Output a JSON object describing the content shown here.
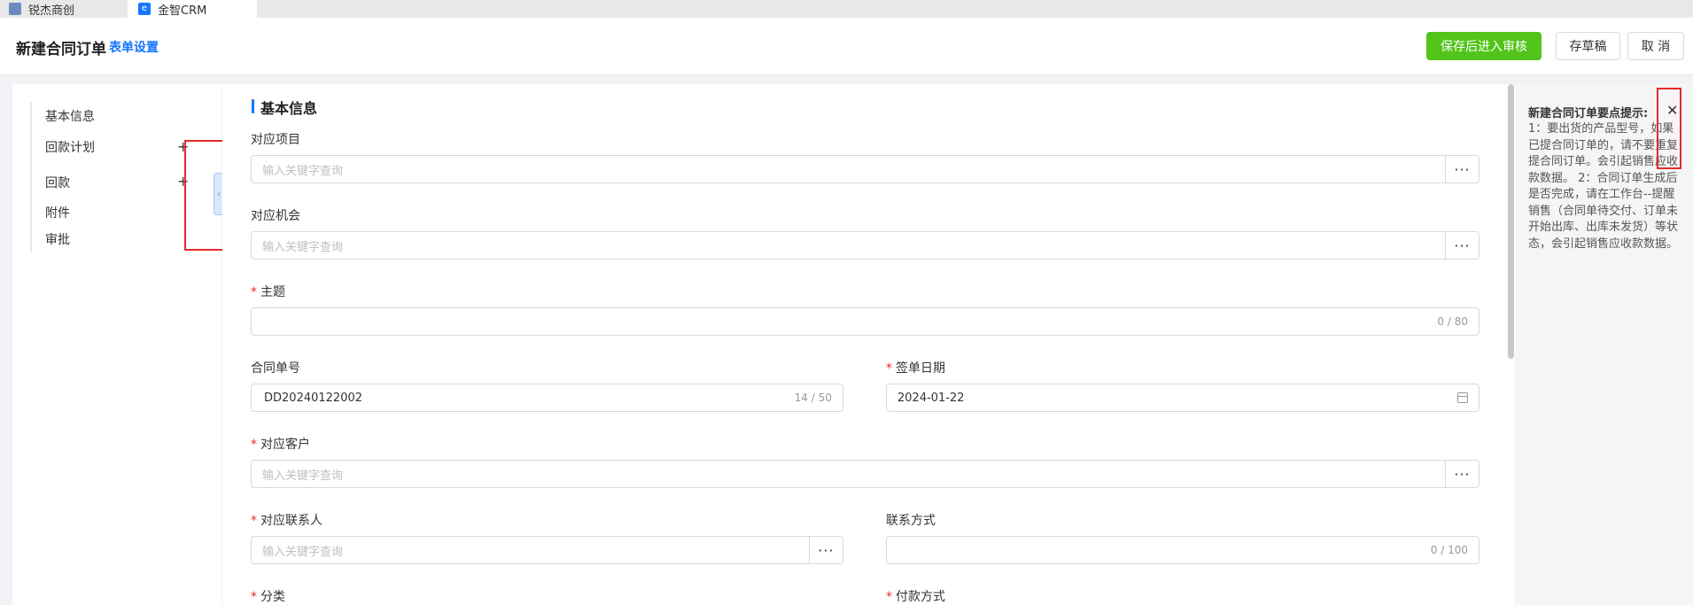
{
  "tabs": [
    {
      "label": "锐杰商创"
    },
    {
      "label": "金智CRM"
    }
  ],
  "header": {
    "title": "新建合同订单",
    "form_settings": "表单设置",
    "submit_label": "保存后进入审核",
    "draft_label": "存草稿",
    "cancel_label": "取 消"
  },
  "sidebar": {
    "items": [
      {
        "label": "基本信息"
      },
      {
        "label": "回款计划"
      },
      {
        "label": "回款"
      },
      {
        "label": "附件"
      },
      {
        "label": "审批"
      }
    ],
    "plus": "+",
    "collapse_glyph": "‹"
  },
  "form": {
    "section_title": "基本信息",
    "required_mark": "*",
    "more_glyph": "···",
    "fields": {
      "project": {
        "label": "对应项目",
        "placeholder": "输入关键字查询"
      },
      "opportunity": {
        "label": "对应机会",
        "placeholder": "输入关键字查询"
      },
      "subject": {
        "label": "主题",
        "value": "",
        "count": "0 / 80"
      },
      "contract_no": {
        "label": "合同单号",
        "value": "DD20240122002",
        "count": "14 / 50"
      },
      "sign_date": {
        "label": "签单日期",
        "value": "2024-01-22"
      },
      "customer": {
        "label": "对应客户",
        "placeholder": "输入关键字查询"
      },
      "contact": {
        "label": "对应联系人",
        "placeholder": "输入关键字查询"
      },
      "contact_method": {
        "label": "联系方式",
        "value": "",
        "count": "0 / 100"
      },
      "category": {
        "label": "分类"
      },
      "payment_method": {
        "label": "付款方式"
      }
    }
  },
  "tips": {
    "title": "新建合同订单要点提示:",
    "body": "1：要出货的产品型号，如果已提合同订单的，请不要重复提合同订单。会引起销售应收款数据。 2：合同订单生成后是否完成，请在工作台--提醒销售（合同单待交付、订单未开始出库、出库未发货）等状态，会引起销售应收款数据。",
    "close_glyph": "✕"
  },
  "colors": {
    "primary_green": "#52c41a",
    "link_blue": "#1677ff",
    "required_red": "#f5222d",
    "highlight_red": "#e52b2b"
  }
}
